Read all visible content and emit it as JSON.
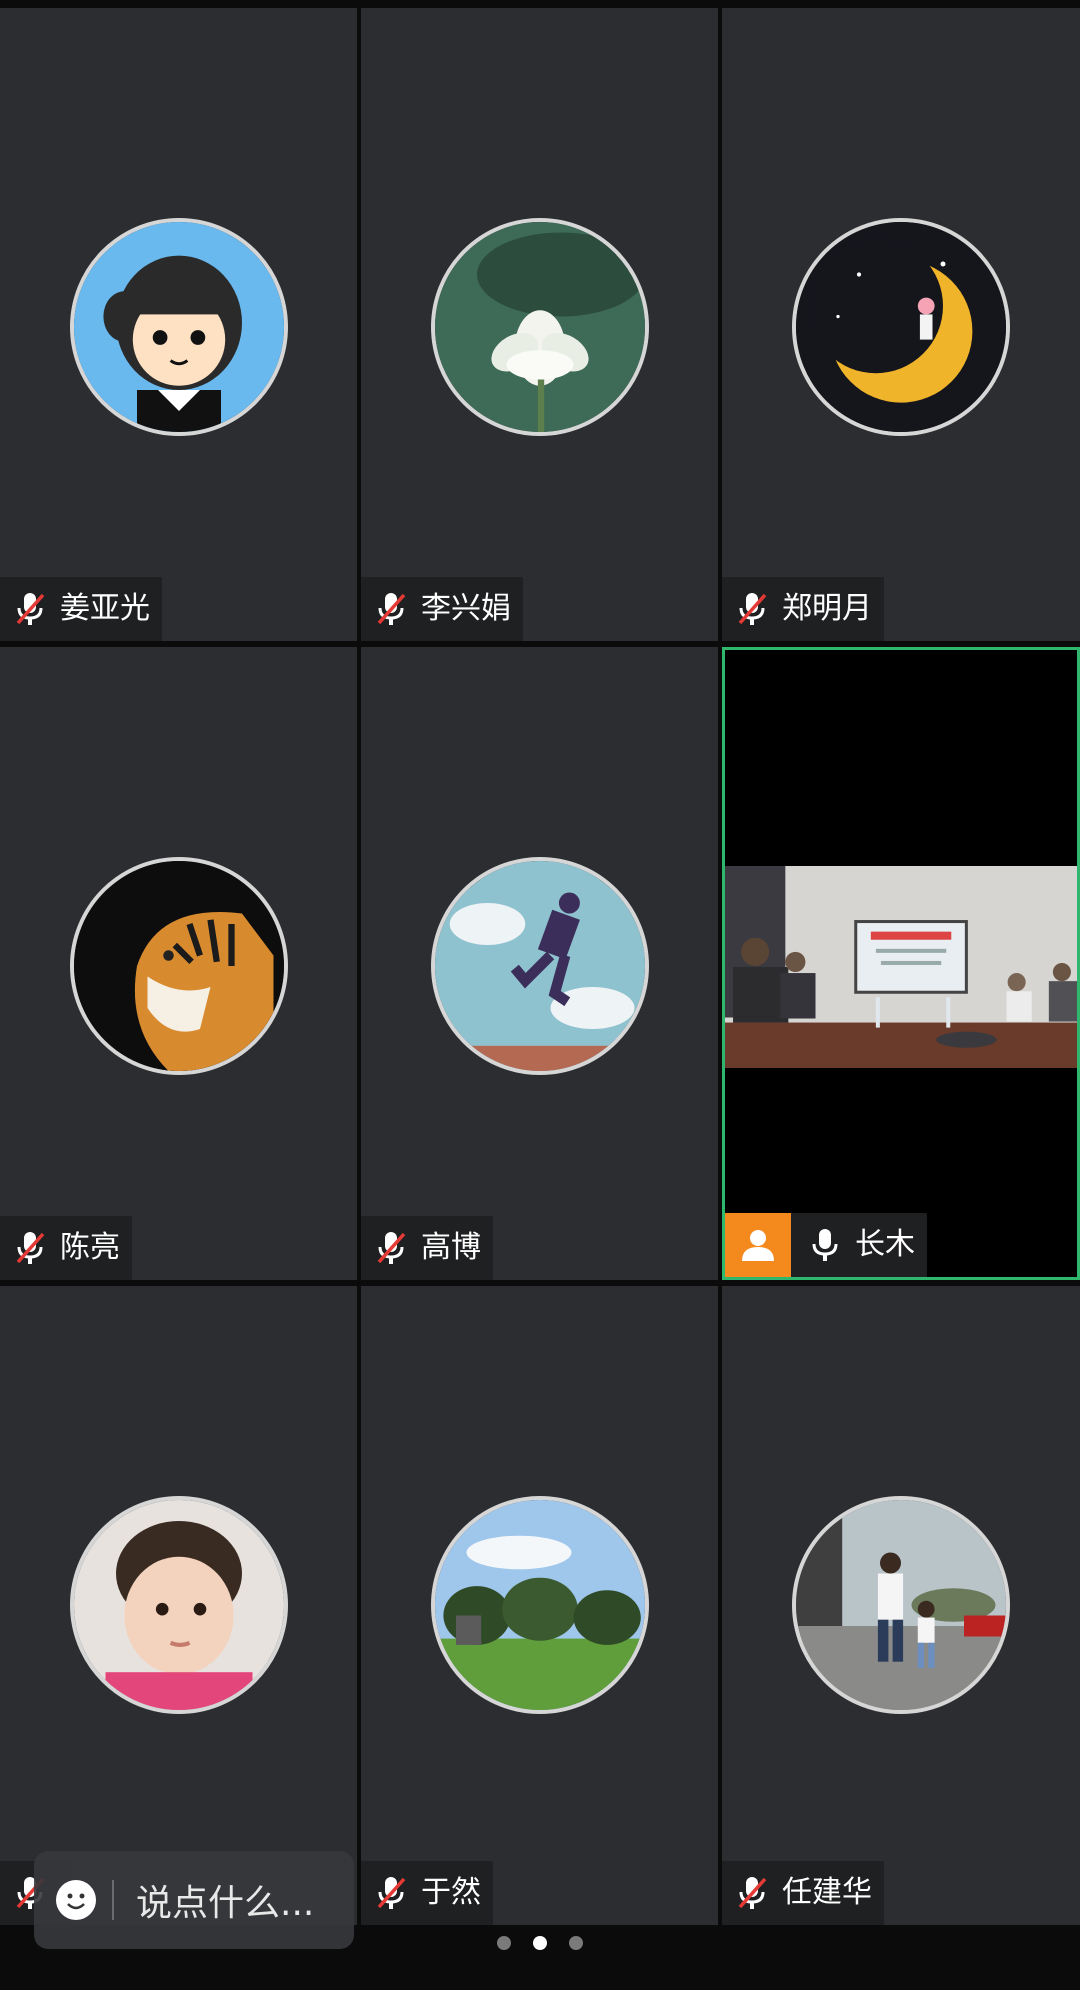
{
  "participants": [
    {
      "name": "姜亚光",
      "mic": "muted",
      "avatar": "cartoon-girl-avatar"
    },
    {
      "name": "李兴娟",
      "mic": "muted",
      "avatar": "lotus-flower-avatar"
    },
    {
      "name": "郑明月",
      "mic": "muted",
      "avatar": "crescent-moon-avatar"
    },
    {
      "name": "陈亮",
      "mic": "muted",
      "avatar": "tiger-avatar"
    },
    {
      "name": "高博",
      "mic": "muted",
      "avatar": "jumping-person-avatar"
    },
    {
      "name": "长木",
      "mic": "on",
      "video": "conference-room-video",
      "host": true
    },
    {
      "name": "",
      "mic": "muted",
      "avatar": "child-portrait-avatar"
    },
    {
      "name": "于然",
      "mic": "muted",
      "avatar": "park-trees-avatar"
    },
    {
      "name": "任建华",
      "mic": "muted",
      "avatar": "father-and-child-walking-avatar"
    }
  ],
  "chat": {
    "placeholder": "说点什么..."
  },
  "pagination": {
    "pages": 3,
    "current": 2
  },
  "colors": {
    "active_border": "#2fb86d",
    "host_badge": "#f48a1e",
    "tile_bg": "#2c2d30"
  }
}
